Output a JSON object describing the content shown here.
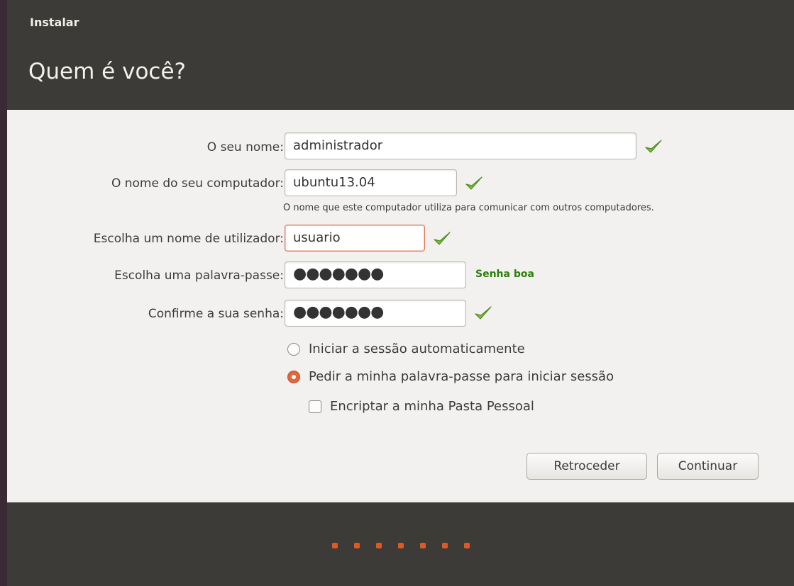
{
  "window": {
    "title": "Instalar",
    "heading": "Quem é você?"
  },
  "form": {
    "name": {
      "label": "O seu nome:",
      "value": "administrador",
      "valid": true
    },
    "computer": {
      "label": "O nome do seu computador:",
      "value": "ubuntu13.04",
      "valid": true,
      "hint": "O nome que este computador utiliza para comunicar com outros computadores."
    },
    "username": {
      "label": "Escolha um nome de utilizador:",
      "value": "usuario",
      "valid": true
    },
    "password": {
      "label": "Escolha uma palavra-passe:",
      "value": "●●●●●●●",
      "strength": "Senha boa"
    },
    "confirm": {
      "label": "Confirme a sua senha:",
      "value": "●●●●●●●",
      "valid": true
    }
  },
  "login_options": {
    "auto_login": {
      "label": "Iniciar a sessão automaticamente",
      "selected": false
    },
    "require_password": {
      "label": "Pedir a minha palavra-passe para iniciar sessão",
      "selected": true
    },
    "encrypt_home": {
      "label": "Encriptar a minha Pasta Pessoal",
      "checked": false
    }
  },
  "buttons": {
    "back": "Retroceder",
    "continue": "Continuar"
  },
  "progress": {
    "steps_shown": 7
  },
  "colors": {
    "accent": "#dd5a26",
    "header_bg": "#3c3b37",
    "content_bg": "#f2f1f0",
    "strength_text": "#2e7d0e",
    "check_green": "#7fbf3a"
  },
  "icons": {
    "valid": "check-icon"
  }
}
